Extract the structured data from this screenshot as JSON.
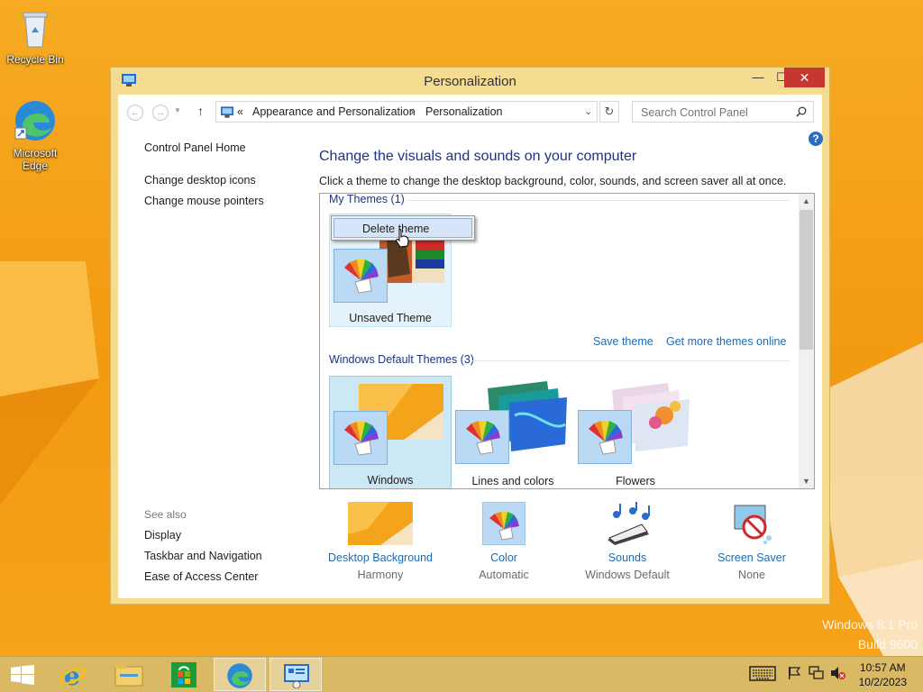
{
  "desktop": {
    "icons": [
      {
        "label": "Recycle Bin"
      },
      {
        "label": "Microsoft Edge"
      }
    ],
    "watermark": {
      "line1": "Windows 8.1 Pro",
      "line2": "Build 9600"
    }
  },
  "window": {
    "title": "Personalization",
    "controls": {
      "minimize": "—",
      "maximize": "☐",
      "close": "✕"
    }
  },
  "addressbar": {
    "overflow": "«",
    "crumbs": [
      "Appearance and Personalization",
      "Personalization"
    ],
    "separator": "›",
    "search_placeholder": "Search Control Panel"
  },
  "leftpane": {
    "links": [
      "Control Panel Home",
      "Change desktop icons",
      "Change mouse pointers"
    ],
    "see_also_header": "See also",
    "see_also": [
      "Display",
      "Taskbar and Navigation",
      "Ease of Access Center"
    ]
  },
  "main": {
    "heading": "Change the visuals and sounds on your computer",
    "subtext": "Click a theme to change the desktop background, color, sounds, and screen saver all at once.",
    "my_themes_header": "My Themes (1)",
    "my_themes": [
      {
        "name": "Unsaved Theme"
      }
    ],
    "actions": {
      "save": "Save theme",
      "more": "Get more themes online"
    },
    "default_themes_header": "Windows Default Themes (3)",
    "default_themes": [
      {
        "name": "Windows"
      },
      {
        "name": "Lines and colors"
      },
      {
        "name": "Flowers"
      }
    ],
    "help": "?"
  },
  "context_menu": {
    "items": [
      "Delete theme"
    ]
  },
  "bottom": [
    {
      "label": "Desktop Background",
      "value": "Harmony"
    },
    {
      "label": "Color",
      "value": "Automatic"
    },
    {
      "label": "Sounds",
      "value": "Windows Default"
    },
    {
      "label": "Screen Saver",
      "value": "None"
    }
  ],
  "taskbar": {
    "apps": [
      "Start",
      "Internet Explorer",
      "File Explorer",
      "Store",
      "Microsoft Edge",
      "Control Panel"
    ],
    "clock": {
      "time": "10:57 AM",
      "date": "10/2/2023"
    }
  },
  "colors": {
    "accent": "#1e6ab4",
    "heading": "#1e3287",
    "window_frame": "#f5dc90",
    "close": "#c7372f",
    "selection": "#cde8f5"
  }
}
